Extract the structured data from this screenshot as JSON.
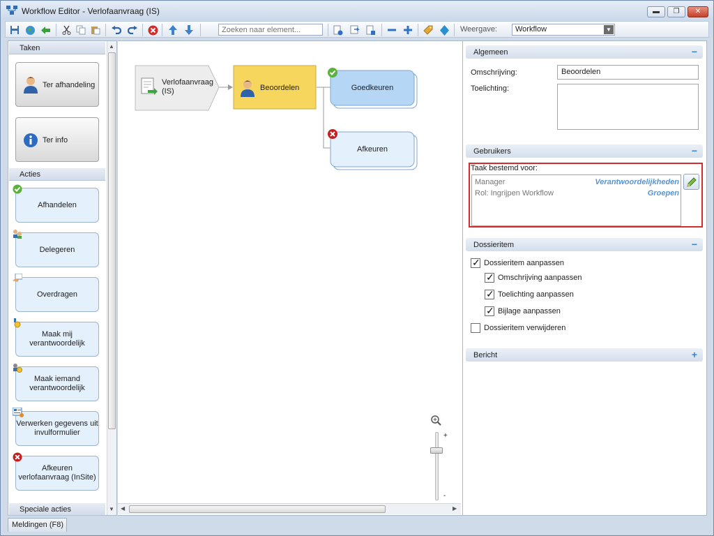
{
  "window": {
    "title": "Workflow Editor - Verlofaanvraag (IS)",
    "minimize": "▬",
    "restore": "❐",
    "close": "✕"
  },
  "toolbar": {
    "search_placeholder": "Zoeken naar element...",
    "view_label": "Weergave:",
    "view_value": "Workflow"
  },
  "left_panel": {
    "tasks_header": "Taken",
    "tasks": [
      {
        "label": "Ter afhandeling",
        "icon": "person-icon"
      },
      {
        "label": "Ter info",
        "icon": "info-icon"
      }
    ],
    "actions_header": "Acties",
    "actions": [
      {
        "label": "Afhandelen",
        "icon": "check-badge-icon"
      },
      {
        "label": "Delegeren",
        "icon": "delegate-icon"
      },
      {
        "label": "Overdragen",
        "icon": "hand-over-icon"
      },
      {
        "label": "Maak mij verantwoordelijk",
        "icon": "responsible-me-icon"
      },
      {
        "label": "Maak iemand verantwoordelijk",
        "icon": "responsible-other-icon"
      },
      {
        "label": "Verwerken gegevens uit invulformulier",
        "icon": "form-process-icon"
      },
      {
        "label": "Afkeuren verlofaanvraag (InSite)",
        "icon": "reject-badge-icon"
      }
    ],
    "special_header": "Speciale acties"
  },
  "canvas": {
    "start_node": "Verlofaanvraag (IS)",
    "task_node": "Beoordelen",
    "approve_node": "Goedkeuren",
    "reject_node": "Afkeuren",
    "zoom_plus": "+",
    "zoom_minus": "-"
  },
  "right_panel": {
    "general": {
      "header": "Algemeen",
      "toggle": "−",
      "description_label": "Omschrijving:",
      "description_value": "Beoordelen",
      "explanation_label": "Toelichting:",
      "explanation_value": ""
    },
    "users": {
      "header": "Gebruikers",
      "toggle": "−",
      "intended_label": "Taak bestemd voor:",
      "rows": [
        {
          "name": "Manager",
          "type": "Verantwoordelijkheden"
        },
        {
          "name": "Rol: Ingrijpen Workflow",
          "type": "Groepen"
        }
      ]
    },
    "dossier": {
      "header": "Dossieritem",
      "toggle": "−",
      "items": [
        {
          "label": "Dossieritem aanpassen",
          "checked": true,
          "indent": 0
        },
        {
          "label": "Omschrijving aanpassen",
          "checked": true,
          "indent": 1
        },
        {
          "label": "Toelichting aanpassen",
          "checked": true,
          "indent": 1
        },
        {
          "label": "Bijlage aanpassen",
          "checked": true,
          "indent": 1
        },
        {
          "label": "Dossieritem verwijderen",
          "checked": false,
          "indent": 0
        }
      ]
    },
    "message": {
      "header": "Bericht",
      "toggle": "+"
    }
  },
  "status_bar": {
    "tab_label": "Meldingen (F8)"
  },
  "colors": {
    "task_node": "#f6d65c",
    "approve_node": "#b5d6f5",
    "action_card": "#e4f0fc",
    "highlight_border": "#d22c2c",
    "link_blue": "#5a94cf"
  }
}
